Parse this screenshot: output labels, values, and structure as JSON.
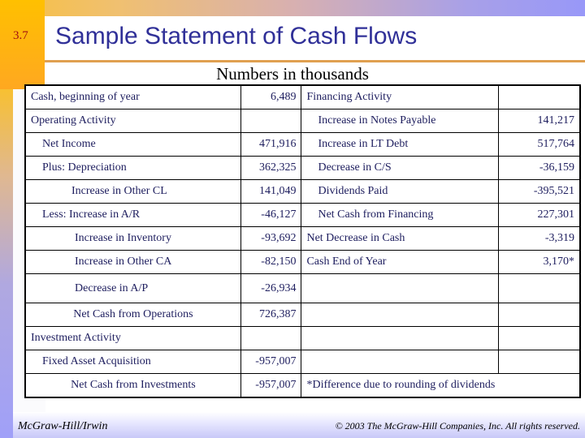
{
  "slide": {
    "number": "3.7",
    "title": "Sample Statement of Cash Flows",
    "subtitle": "Numbers in thousands"
  },
  "rows": [
    {
      "l": "Cash, beginning of year",
      "lv": "6,489",
      "r": "Financing Activity",
      "rv": ""
    },
    {
      "l": "Operating Activity",
      "lv": "",
      "r": "Increase in Notes Payable",
      "rv": "141,217"
    },
    {
      "l": "Net Income",
      "lv": "471,916",
      "r": "Increase in LT Debt",
      "rv": "517,764"
    },
    {
      "l": "Plus: Depreciation",
      "lv": "362,325",
      "r": "Decrease in C/S",
      "rv": "-36,159"
    },
    {
      "l": "Increase in Other CL",
      "lv": "141,049",
      "r": "Dividends Paid",
      "rv": "-395,521"
    },
    {
      "l": "Less: Increase in A/R",
      "lv": "-46,127",
      "r": "Net Cash from Financing",
      "rv": "227,301"
    },
    {
      "l": "Increase in Inventory",
      "lv": "-93,692",
      "r": "Net Decrease in Cash",
      "rv": "-3,319"
    },
    {
      "l": "Increase in Other CA",
      "lv": "-82,150",
      "r": "Cash End of Year",
      "rv": "3,170*"
    },
    {
      "l": "Decrease in A/P",
      "lv": "-26,934",
      "r": "",
      "rv": ""
    },
    {
      "l": "Net Cash from Operations",
      "lv": "726,387",
      "r": "",
      "rv": ""
    },
    {
      "l": "Investment Activity",
      "lv": "",
      "r": "",
      "rv": ""
    },
    {
      "l": "Fixed Asset Acquisition",
      "lv": "-957,007",
      "r": "",
      "rv": ""
    },
    {
      "l": "Net Cash from Investments",
      "lv": "-957,007",
      "footnote": "*Difference due to rounding of dividends"
    }
  ],
  "footer": {
    "publisher": "McGraw-Hill/Irwin",
    "copyright": "© 2003 The McGraw-Hill Companies, Inc. All rights reserved."
  }
}
